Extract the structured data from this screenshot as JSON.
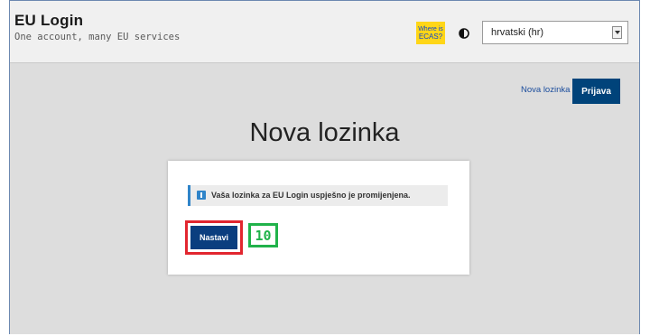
{
  "header": {
    "title": "EU Login",
    "subtitle": "One account, many EU services",
    "where_is_ecas_line1": "Where is",
    "where_is_ecas_line2": "ECAS?",
    "contrast_icon": "contrast-icon",
    "language_selected": "hrvatski (hr)"
  },
  "nav": {
    "new_password_link": "Nova lozinka",
    "login_button": "Prijava"
  },
  "main": {
    "page_title": "Nova lozinka",
    "message": "Vaša lozinka za EU Login uspješno je promijenjena.",
    "info_icon": "info-icon",
    "continue_button": "Nastavi",
    "step_annotation": "10"
  },
  "colors": {
    "accent": "#00437a",
    "ecas_badge": "#ffd617",
    "highlight_red": "#e2262f",
    "highlight_green": "#20b24a",
    "info_blue": "#2f84c9"
  }
}
